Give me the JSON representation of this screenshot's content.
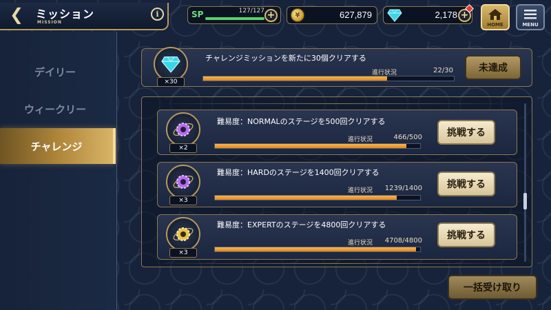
{
  "header": {
    "title": "ミッション",
    "subtitle": "MISSION",
    "info_label": "i",
    "sp": {
      "label": "SP",
      "value": "127/127",
      "fill": 1.0
    },
    "coins": {
      "value": "627,879"
    },
    "gems": {
      "value": "2,178"
    },
    "home_label": "HOME",
    "menu_label": "MENU"
  },
  "sidebar": {
    "tabs": [
      {
        "label": "デイリー"
      },
      {
        "label": "ウィークリー"
      },
      {
        "label": "チャレンジ",
        "selected": true
      }
    ]
  },
  "featured": {
    "count_label": "×30",
    "text": "チャレンジミッションを新たに30個クリアする",
    "progress_label": "進行状況",
    "progress_value": "22/30",
    "progress_fraction": 0.733,
    "status_label": "未達成"
  },
  "missions": [
    {
      "count_label": "×2",
      "text": "難易度：NORMALのステージを500回クリアする",
      "progress_label": "進行状況",
      "progress_value": "466/500",
      "progress_fraction": 0.932,
      "button_label": "挑戦する",
      "icon": "purple-gear-icon"
    },
    {
      "count_label": "×3",
      "text": "難易度：HARDのステージを1400回クリアする",
      "progress_label": "進行状況",
      "progress_value": "1239/1400",
      "progress_fraction": 0.885,
      "button_label": "挑戦する",
      "icon": "purple-gear-icon"
    },
    {
      "count_label": "×3",
      "text": "難易度：EXPERTのステージを4800回クリアする",
      "progress_label": "進行状況",
      "progress_value": "4708/4800",
      "progress_fraction": 0.981,
      "button_label": "挑戦する",
      "icon": "gold-gear-icon"
    }
  ],
  "claim_all_label": "一括受け取り",
  "colors": {
    "accent_gold": "#b89a5c",
    "progress_orange": "#f0a035",
    "sp_green": "#58d36a",
    "gem_cyan": "#38d6e8",
    "purple_gear": "#b46cf0"
  }
}
